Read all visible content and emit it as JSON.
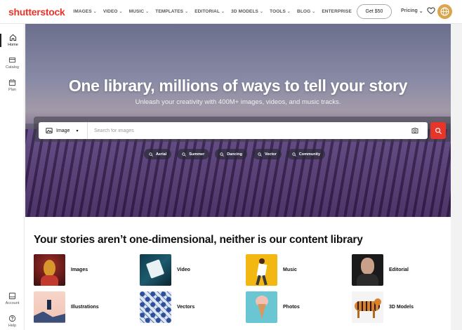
{
  "brand": {
    "logo_text": "shutterstock",
    "accent": "#e8352a"
  },
  "nav": {
    "items": [
      {
        "label": "IMAGES",
        "caret": true
      },
      {
        "label": "VIDEO",
        "caret": true
      },
      {
        "label": "MUSIC",
        "caret": true
      },
      {
        "label": "TEMPLATES",
        "caret": true
      },
      {
        "label": "EDITORIAL",
        "caret": true
      },
      {
        "label": "3D MODELS",
        "caret": true
      },
      {
        "label": "TOOLS",
        "caret": true
      },
      {
        "label": "BLOG",
        "caret": true
      },
      {
        "label": "ENTERPRISE",
        "caret": false
      }
    ],
    "get_offer": "Get $50",
    "pricing": "Pricing",
    "caret": "⌄"
  },
  "sidebar": {
    "top": [
      {
        "label": "Home",
        "icon": "home-icon"
      },
      {
        "label": "Catalog",
        "icon": "catalog-icon"
      },
      {
        "label": "Plan",
        "icon": "calendar-icon"
      }
    ],
    "bottom": [
      {
        "label": "Account",
        "icon": "account-icon"
      },
      {
        "label": "Help",
        "icon": "help-icon"
      }
    ]
  },
  "hero": {
    "title": "One library, millions of ways to tell your story",
    "subtitle": "Unleash your creativity with 400M+ images, videos, and music tracks.",
    "search": {
      "type_label": "Image",
      "placeholder": "Search for images",
      "value": ""
    },
    "chips": [
      "Aerial",
      "Summer",
      "Dancing",
      "Vector",
      "Community"
    ]
  },
  "content": {
    "title": "Your stories aren’t one-dimensional, neither is our content library",
    "categories": [
      {
        "label": "Images"
      },
      {
        "label": "Video"
      },
      {
        "label": "Music"
      },
      {
        "label": "Editorial"
      },
      {
        "label": "Illustrations"
      },
      {
        "label": "Vectors"
      },
      {
        "label": "Photos"
      },
      {
        "label": "3D Models"
      }
    ]
  }
}
